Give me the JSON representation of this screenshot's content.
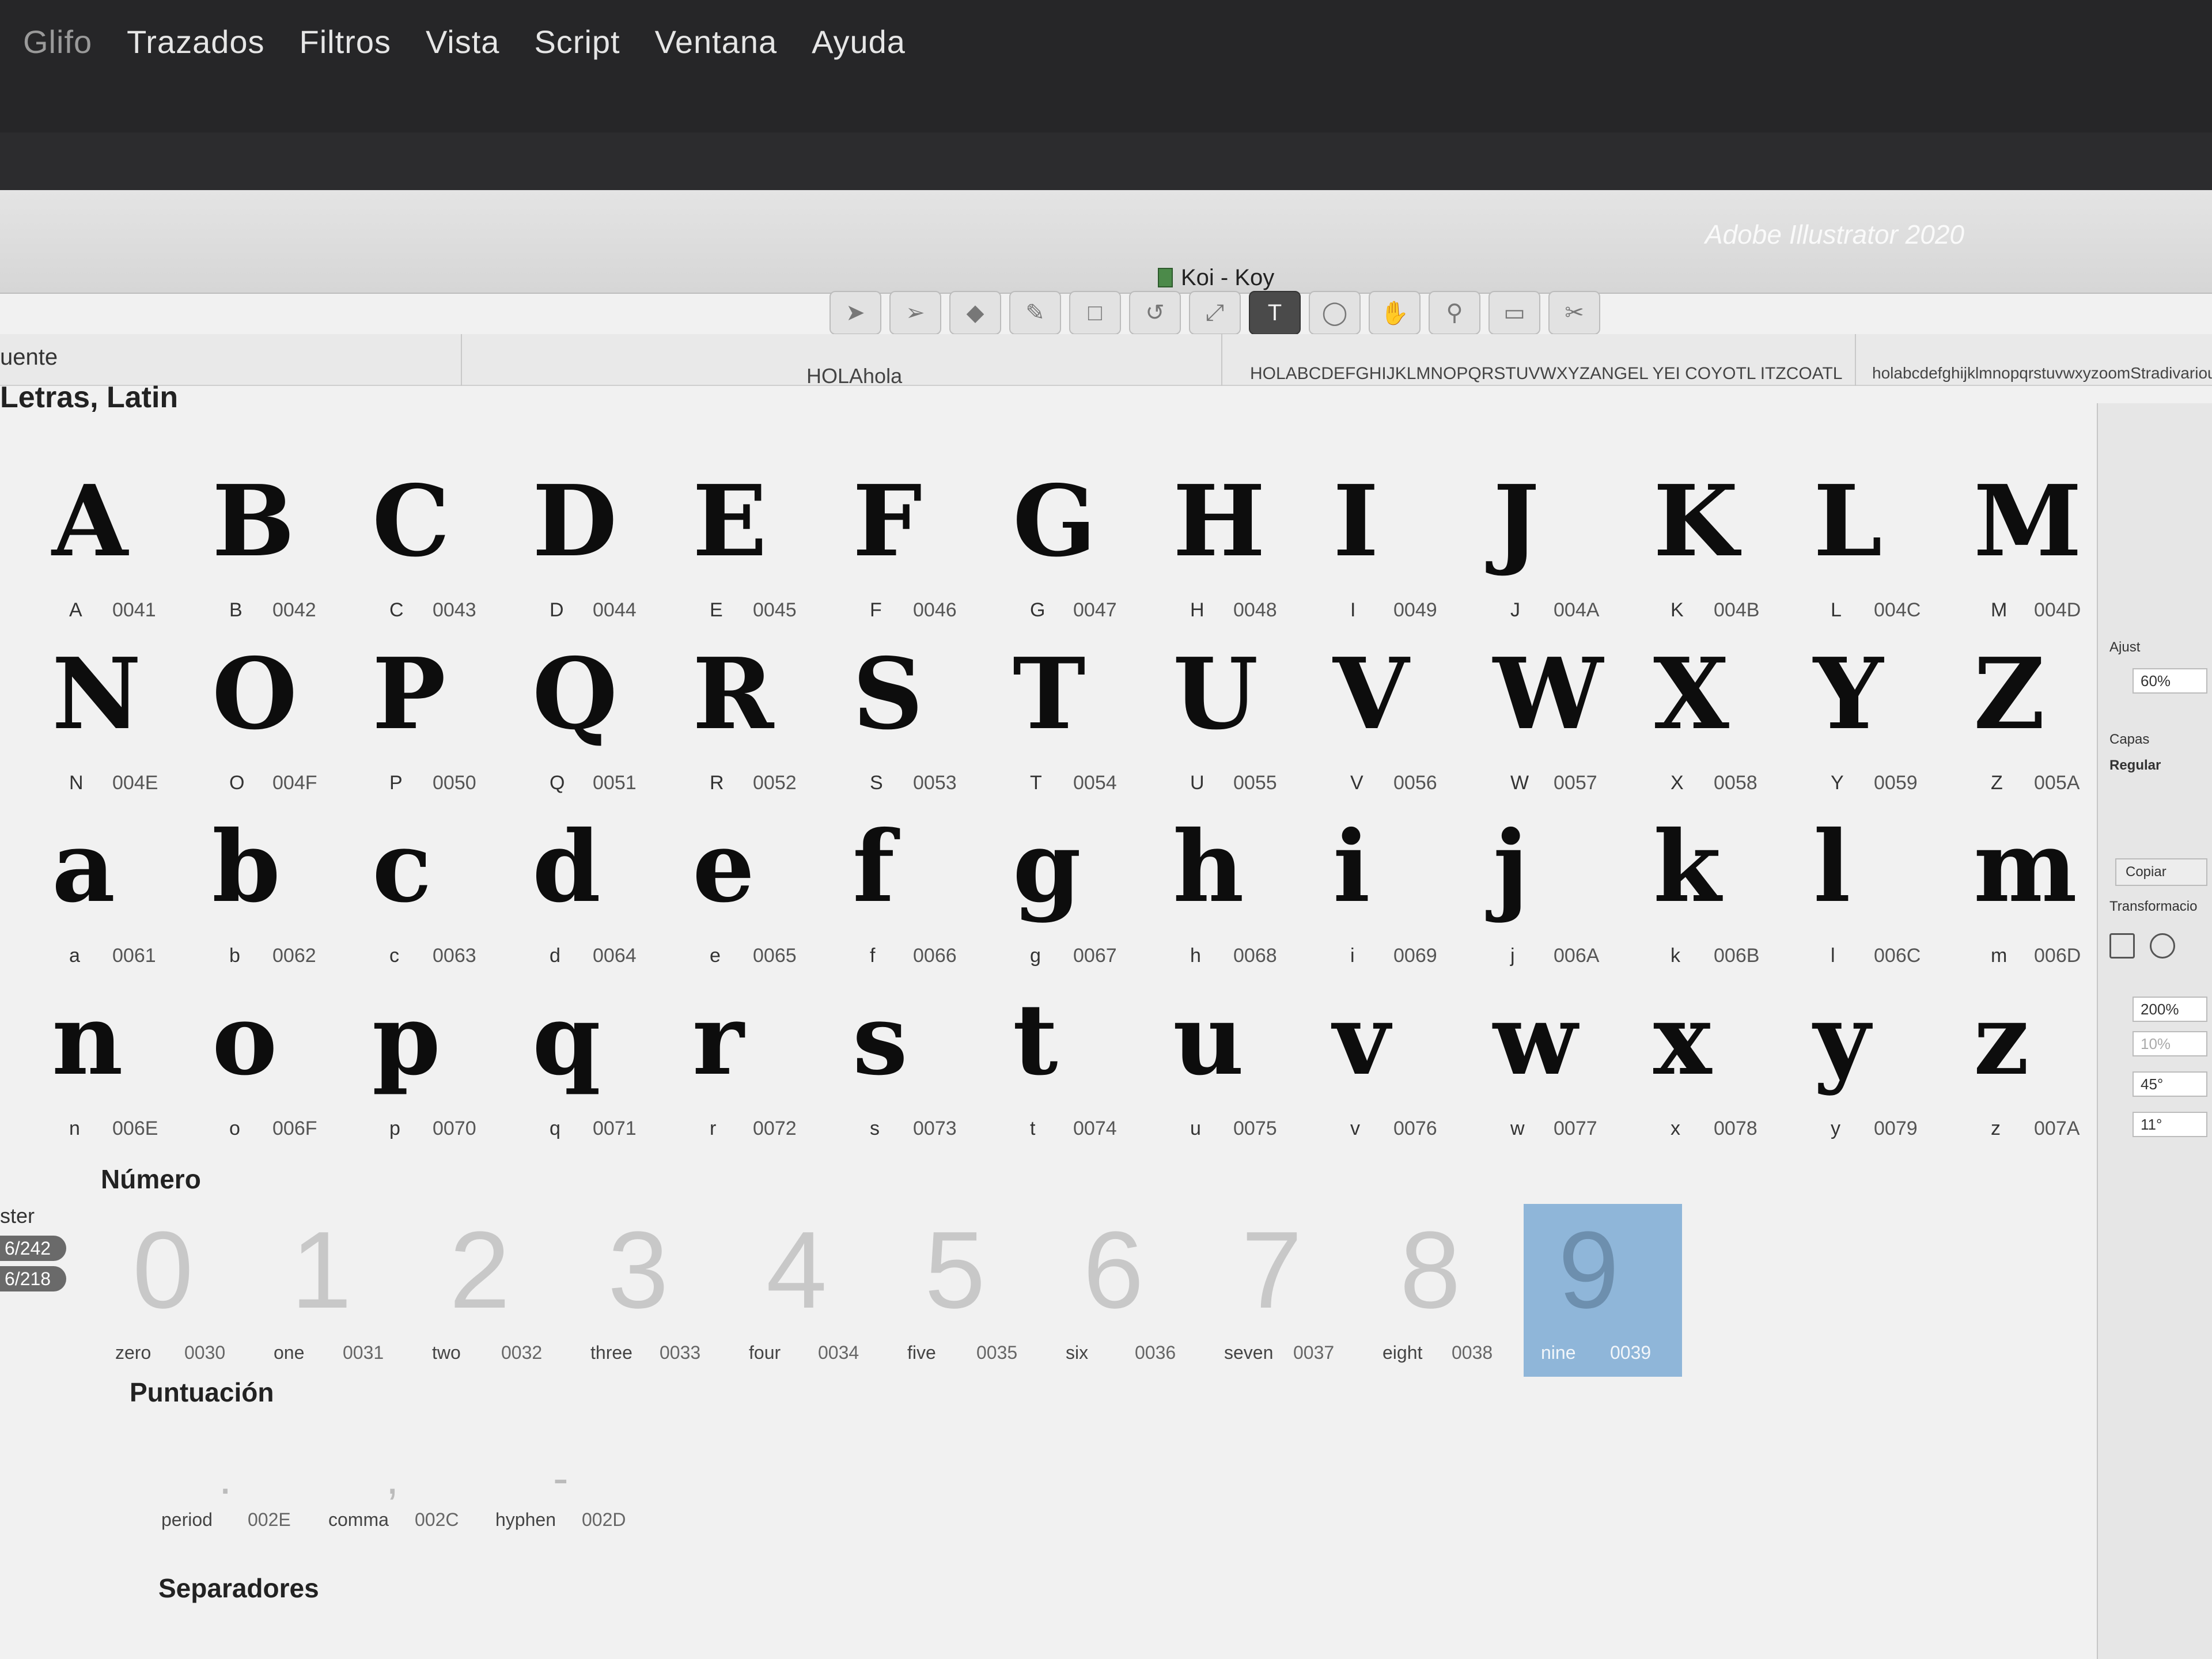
{
  "menubar": {
    "items": [
      "Glifo",
      "Trazados",
      "Filtros",
      "Vista",
      "Script",
      "Ventana",
      "Ayuda"
    ]
  },
  "window": {
    "app_title": "Adobe Illustrator 2020",
    "doc_title": "Koi - Koy",
    "font_tab": "uente"
  },
  "toolbar": {
    "tools": [
      "arrow-icon",
      "direct-select-icon",
      "eraser-icon",
      "pencil-icon",
      "rectangle-icon",
      "rotate-icon",
      "scale-icon",
      "text-icon",
      "speech-icon",
      "hand-icon",
      "zoom-icon",
      "measure-icon",
      "knife-icon"
    ],
    "active": "text-icon"
  },
  "samples": {
    "text1": "HOLAhola",
    "text2": "HOLABCDEFGHIJKLMNOPQRSTUVWXYZANGEL YEI COYOTL ITZCOATL",
    "text3": "holabcdefghijklmnopqrstuvwxyzoomStradivarious"
  },
  "sections": {
    "letras": "Letras, Latin",
    "numero": "Número",
    "puntuacion": "Puntuación",
    "separadores": "Separadores"
  },
  "glyph_rows": [
    [
      {
        "char": "A",
        "name": "A",
        "code": "0041"
      },
      {
        "char": "B",
        "name": "B",
        "code": "0042"
      },
      {
        "char": "C",
        "name": "C",
        "code": "0043"
      },
      {
        "char": "D",
        "name": "D",
        "code": "0044"
      },
      {
        "char": "E",
        "name": "E",
        "code": "0045"
      },
      {
        "char": "F",
        "name": "F",
        "code": "0046"
      },
      {
        "char": "G",
        "name": "G",
        "code": "0047"
      },
      {
        "char": "H",
        "name": "H",
        "code": "0048"
      },
      {
        "char": "I",
        "name": "I",
        "code": "0049"
      },
      {
        "char": "J",
        "name": "J",
        "code": "004A"
      },
      {
        "char": "K",
        "name": "K",
        "code": "004B"
      },
      {
        "char": "L",
        "name": "L",
        "code": "004C"
      },
      {
        "char": "M",
        "name": "M",
        "code": "004D"
      }
    ],
    [
      {
        "char": "N",
        "name": "N",
        "code": "004E"
      },
      {
        "char": "O",
        "name": "O",
        "code": "004F"
      },
      {
        "char": "P",
        "name": "P",
        "code": "0050"
      },
      {
        "char": "Q",
        "name": "Q",
        "code": "0051"
      },
      {
        "char": "R",
        "name": "R",
        "code": "0052"
      },
      {
        "char": "S",
        "name": "S",
        "code": "0053"
      },
      {
        "char": "T",
        "name": "T",
        "code": "0054"
      },
      {
        "char": "U",
        "name": "U",
        "code": "0055"
      },
      {
        "char": "V",
        "name": "V",
        "code": "0056"
      },
      {
        "char": "W",
        "name": "W",
        "code": "0057"
      },
      {
        "char": "X",
        "name": "X",
        "code": "0058"
      },
      {
        "char": "Y",
        "name": "Y",
        "code": "0059"
      },
      {
        "char": "Z",
        "name": "Z",
        "code": "005A"
      }
    ],
    [
      {
        "char": "a",
        "name": "a",
        "code": "0061"
      },
      {
        "char": "b",
        "name": "b",
        "code": "0062"
      },
      {
        "char": "c",
        "name": "c",
        "code": "0063"
      },
      {
        "char": "d",
        "name": "d",
        "code": "0064"
      },
      {
        "char": "e",
        "name": "e",
        "code": "0065"
      },
      {
        "char": "f",
        "name": "f",
        "code": "0066"
      },
      {
        "char": "g",
        "name": "g",
        "code": "0067"
      },
      {
        "char": "h",
        "name": "h",
        "code": "0068"
      },
      {
        "char": "i",
        "name": "i",
        "code": "0069"
      },
      {
        "char": "j",
        "name": "j",
        "code": "006A"
      },
      {
        "char": "k",
        "name": "k",
        "code": "006B"
      },
      {
        "char": "l",
        "name": "l",
        "code": "006C"
      },
      {
        "char": "m",
        "name": "m",
        "code": "006D"
      }
    ],
    [
      {
        "char": "n",
        "name": "n",
        "code": "006E"
      },
      {
        "char": "o",
        "name": "o",
        "code": "006F"
      },
      {
        "char": "p",
        "name": "p",
        "code": "0070"
      },
      {
        "char": "q",
        "name": "q",
        "code": "0071"
      },
      {
        "char": "r",
        "name": "r",
        "code": "0072"
      },
      {
        "char": "s",
        "name": "s",
        "code": "0073"
      },
      {
        "char": "t",
        "name": "t",
        "code": "0074"
      },
      {
        "char": "u",
        "name": "u",
        "code": "0075"
      },
      {
        "char": "v",
        "name": "v",
        "code": "0076"
      },
      {
        "char": "w",
        "name": "w",
        "code": "0077"
      },
      {
        "char": "x",
        "name": "x",
        "code": "0078"
      },
      {
        "char": "y",
        "name": "y",
        "code": "0079"
      },
      {
        "char": "z",
        "name": "z",
        "code": "007A"
      }
    ]
  ],
  "numbers": [
    {
      "char": "0",
      "name": "zero",
      "code": "0030"
    },
    {
      "char": "1",
      "name": "one",
      "code": "0031"
    },
    {
      "char": "2",
      "name": "two",
      "code": "0032"
    },
    {
      "char": "3",
      "name": "three",
      "code": "0033"
    },
    {
      "char": "4",
      "name": "four",
      "code": "0034"
    },
    {
      "char": "5",
      "name": "five",
      "code": "0035"
    },
    {
      "char": "6",
      "name": "six",
      "code": "0036"
    },
    {
      "char": "7",
      "name": "seven",
      "code": "0037"
    },
    {
      "char": "8",
      "name": "eight",
      "code": "0038"
    },
    {
      "char": "9",
      "name": "nine",
      "code": "0039",
      "selected": true
    }
  ],
  "punctuation": [
    {
      "char": ".",
      "name": "period",
      "code": "002E"
    },
    {
      "char": ",",
      "name": "comma",
      "code": "002C"
    },
    {
      "char": "-",
      "name": "hyphen",
      "code": "002D"
    }
  ],
  "left_sidebar": {
    "label": "ster",
    "badge1": "6/242",
    "badge2": "6/218"
  },
  "right_panel": {
    "ajustes": "Ajust",
    "zoom": "60%",
    "capas": "Capas",
    "regular": "Regular",
    "copiar": "Copiar",
    "transformacion": "Transformacio",
    "scale": "200%",
    "scale2": "10%",
    "angle": "45°",
    "slant": "11°"
  },
  "colors": {
    "selection": "#8fb6d9",
    "active_tool": "#4a4a4a",
    "warning": "#d9a21e"
  }
}
